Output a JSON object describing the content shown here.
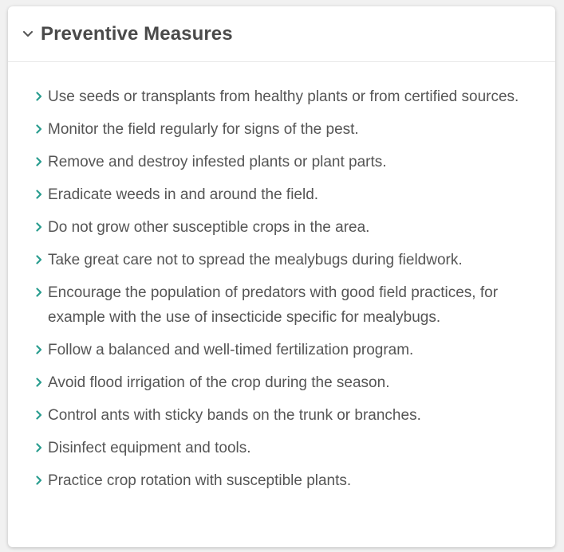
{
  "section": {
    "title": "Preventive Measures",
    "expanded_icon": "chevron-down-icon",
    "bullet_icon": "chevron-right-icon",
    "bullet_color": "#2a9d8f",
    "items": [
      "Use seeds or transplants from healthy plants or from certified sources.",
      "Monitor the field regularly for signs of the pest.",
      "Remove and destroy infested plants or plant parts.",
      "Eradicate weeds in and around the field.",
      "Do not grow other susceptible crops in the area.",
      "Take great care not to spread the mealybugs during fieldwork.",
      "Encourage the population of predators with good field practices, for example with the use of insecticide specific for mealybugs.",
      "Follow a balanced and well-timed fertilization program.",
      "Avoid flood irrigation of the crop during the season.",
      "Control ants with sticky bands on the trunk or branches.",
      "Disinfect equipment and tools.",
      "Practice crop rotation with susceptible plants."
    ]
  }
}
